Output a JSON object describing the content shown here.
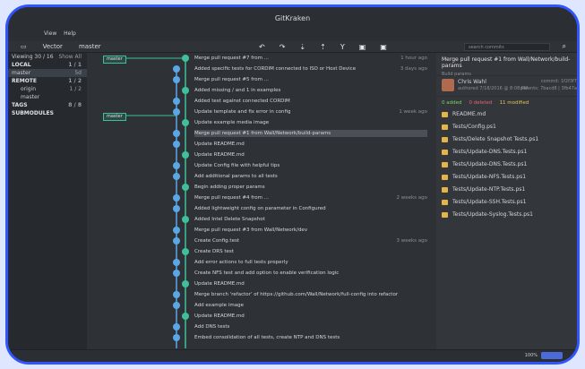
{
  "window": {
    "title": "GitKraken"
  },
  "menu": [
    "View",
    "Help"
  ],
  "toolbar": {
    "repo": "Vector",
    "branch": "master",
    "search_placeholder": "search commits"
  },
  "sidebar": {
    "columns": [
      "Viewing 30 / 16",
      "Show All"
    ],
    "rows": [
      {
        "label": "LOCAL",
        "count": "1 / 1",
        "type": "header"
      },
      {
        "label": "master",
        "count": "5d",
        "type": "selected"
      },
      {
        "label": "REMOTE",
        "count": "1 / 2",
        "type": "header"
      },
      {
        "label": "origin",
        "count": "1 / 2",
        "type": "child"
      },
      {
        "label": "master",
        "count": "",
        "type": "child"
      },
      {
        "label": "TAGS",
        "count": "8 / 8",
        "type": "header"
      },
      {
        "label": "SUBMODULES",
        "count": "",
        "type": "header"
      }
    ]
  },
  "branch_tags": [
    "master",
    "master"
  ],
  "commits": [
    {
      "msg": "Merge pull request #7 from ...",
      "time": "1 hour ago"
    },
    {
      "msg": "Added specific tests for CORDIM connected to ISO or Host Device",
      "time": "3 days ago"
    },
    {
      "msg": "Merge pull request #5 from ...",
      "time": ""
    },
    {
      "msg": "Added missing / and 1 in examples",
      "time": ""
    },
    {
      "msg": "Added test against connected CORDIM",
      "time": ""
    },
    {
      "msg": "Update template and fix error in config",
      "time": "1 week ago"
    },
    {
      "msg": "Update example media image",
      "time": ""
    },
    {
      "msg": "Merge pull request #1 from Wall/Network/build-params",
      "time": "",
      "selected": true
    },
    {
      "msg": "Update README.md",
      "time": ""
    },
    {
      "msg": "Update README.md",
      "time": ""
    },
    {
      "msg": "Update Config file with helpful tips",
      "time": ""
    },
    {
      "msg": "Add additional params to all tests",
      "time": ""
    },
    {
      "msg": "Begin adding proper params",
      "time": ""
    },
    {
      "msg": "Merge pull request #4 from ...",
      "time": "2 weeks ago"
    },
    {
      "msg": "Added lightweight config on parameter in Configured",
      "time": ""
    },
    {
      "msg": "Added Intel Delete Snapshot",
      "time": ""
    },
    {
      "msg": "Merge pull request #3 from Wall/Network/dev",
      "time": ""
    },
    {
      "msg": "Create Config.test",
      "time": "3 weeks ago"
    },
    {
      "msg": "Create DRS test",
      "time": ""
    },
    {
      "msg": "Add error actions to full tests properly",
      "time": ""
    },
    {
      "msg": "Create NFS test and add option to enable verification logic",
      "time": ""
    },
    {
      "msg": "Update README.md",
      "time": ""
    },
    {
      "msg": "Merge branch 'refactor' of https://github.com/Wall/Network/full-config into refactor",
      "time": ""
    },
    {
      "msg": "Add example image",
      "time": ""
    },
    {
      "msg": "Update README.md",
      "time": ""
    },
    {
      "msg": "Add DNS tests",
      "time": ""
    },
    {
      "msg": "Embed consolidation of all tests, create NTP and DNS tests",
      "time": ""
    }
  ],
  "detail": {
    "message": "Merge pull request #1 from Wall/Network/build-params",
    "sub": "Build params",
    "author": "Chris Wahl",
    "date": "authored 7/18/2016 @ 8:08 PM",
    "meta1": "commit: 1f2f3f7",
    "meta2": "parents: 7bacd8 | 3fb47a",
    "added": "0 added",
    "deleted": "0 deleted",
    "modified": "11 modified",
    "files": [
      "README.md",
      "Tests/Config.ps1",
      "Tests/Delete Snapshot Tests.ps1",
      "Tests/Update-DNS.Tests.ps1",
      "Tests/Update-DNS.Tests.ps1",
      "Tests/Update-NFS.Tests.ps1",
      "Tests/Update-NTP.Tests.ps1",
      "Tests/Update-SSH.Tests.ps1",
      "Tests/Update-Syslog.Tests.ps1"
    ]
  },
  "status": {
    "zoom": "100%"
  }
}
